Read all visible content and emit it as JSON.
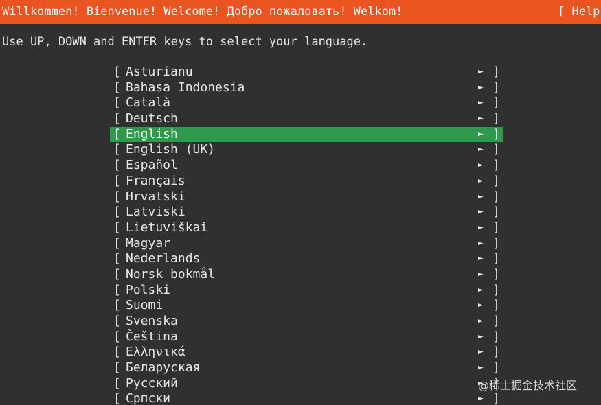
{
  "header": {
    "title": "Willkommen! Bienvenue! Welcome! Добро пожаловать! Welkom!",
    "help": "[ Help"
  },
  "instructions": "Use UP, DOWN and ENTER keys to select your language.",
  "languages": [
    {
      "label": "Asturianu",
      "selected": false
    },
    {
      "label": "Bahasa Indonesia",
      "selected": false
    },
    {
      "label": "Català",
      "selected": false
    },
    {
      "label": "Deutsch",
      "selected": false
    },
    {
      "label": "English",
      "selected": true
    },
    {
      "label": "English (UK)",
      "selected": false
    },
    {
      "label": "Español",
      "selected": false
    },
    {
      "label": "Français",
      "selected": false
    },
    {
      "label": "Hrvatski",
      "selected": false
    },
    {
      "label": "Latviski",
      "selected": false
    },
    {
      "label": "Lietuviškai",
      "selected": false
    },
    {
      "label": "Magyar",
      "selected": false
    },
    {
      "label": "Nederlands",
      "selected": false
    },
    {
      "label": "Norsk bokmål",
      "selected": false
    },
    {
      "label": "Polski",
      "selected": false
    },
    {
      "label": "Suomi",
      "selected": false
    },
    {
      "label": "Svenska",
      "selected": false
    },
    {
      "label": "Čeština",
      "selected": false
    },
    {
      "label": "Ελληνικά",
      "selected": false
    },
    {
      "label": "Беларуская",
      "selected": false
    },
    {
      "label": "Русский",
      "selected": false
    },
    {
      "label": "Српски",
      "selected": false
    }
  ],
  "item_open_bracket": "[",
  "item_close_bracket": "]",
  "item_arrow": "►",
  "watermark": "@稀土掘金技术社区",
  "colors": {
    "header_bg": "#e95420",
    "background": "#2f302f",
    "selection": "#2f9a4a",
    "text": "#e6e6e6"
  }
}
